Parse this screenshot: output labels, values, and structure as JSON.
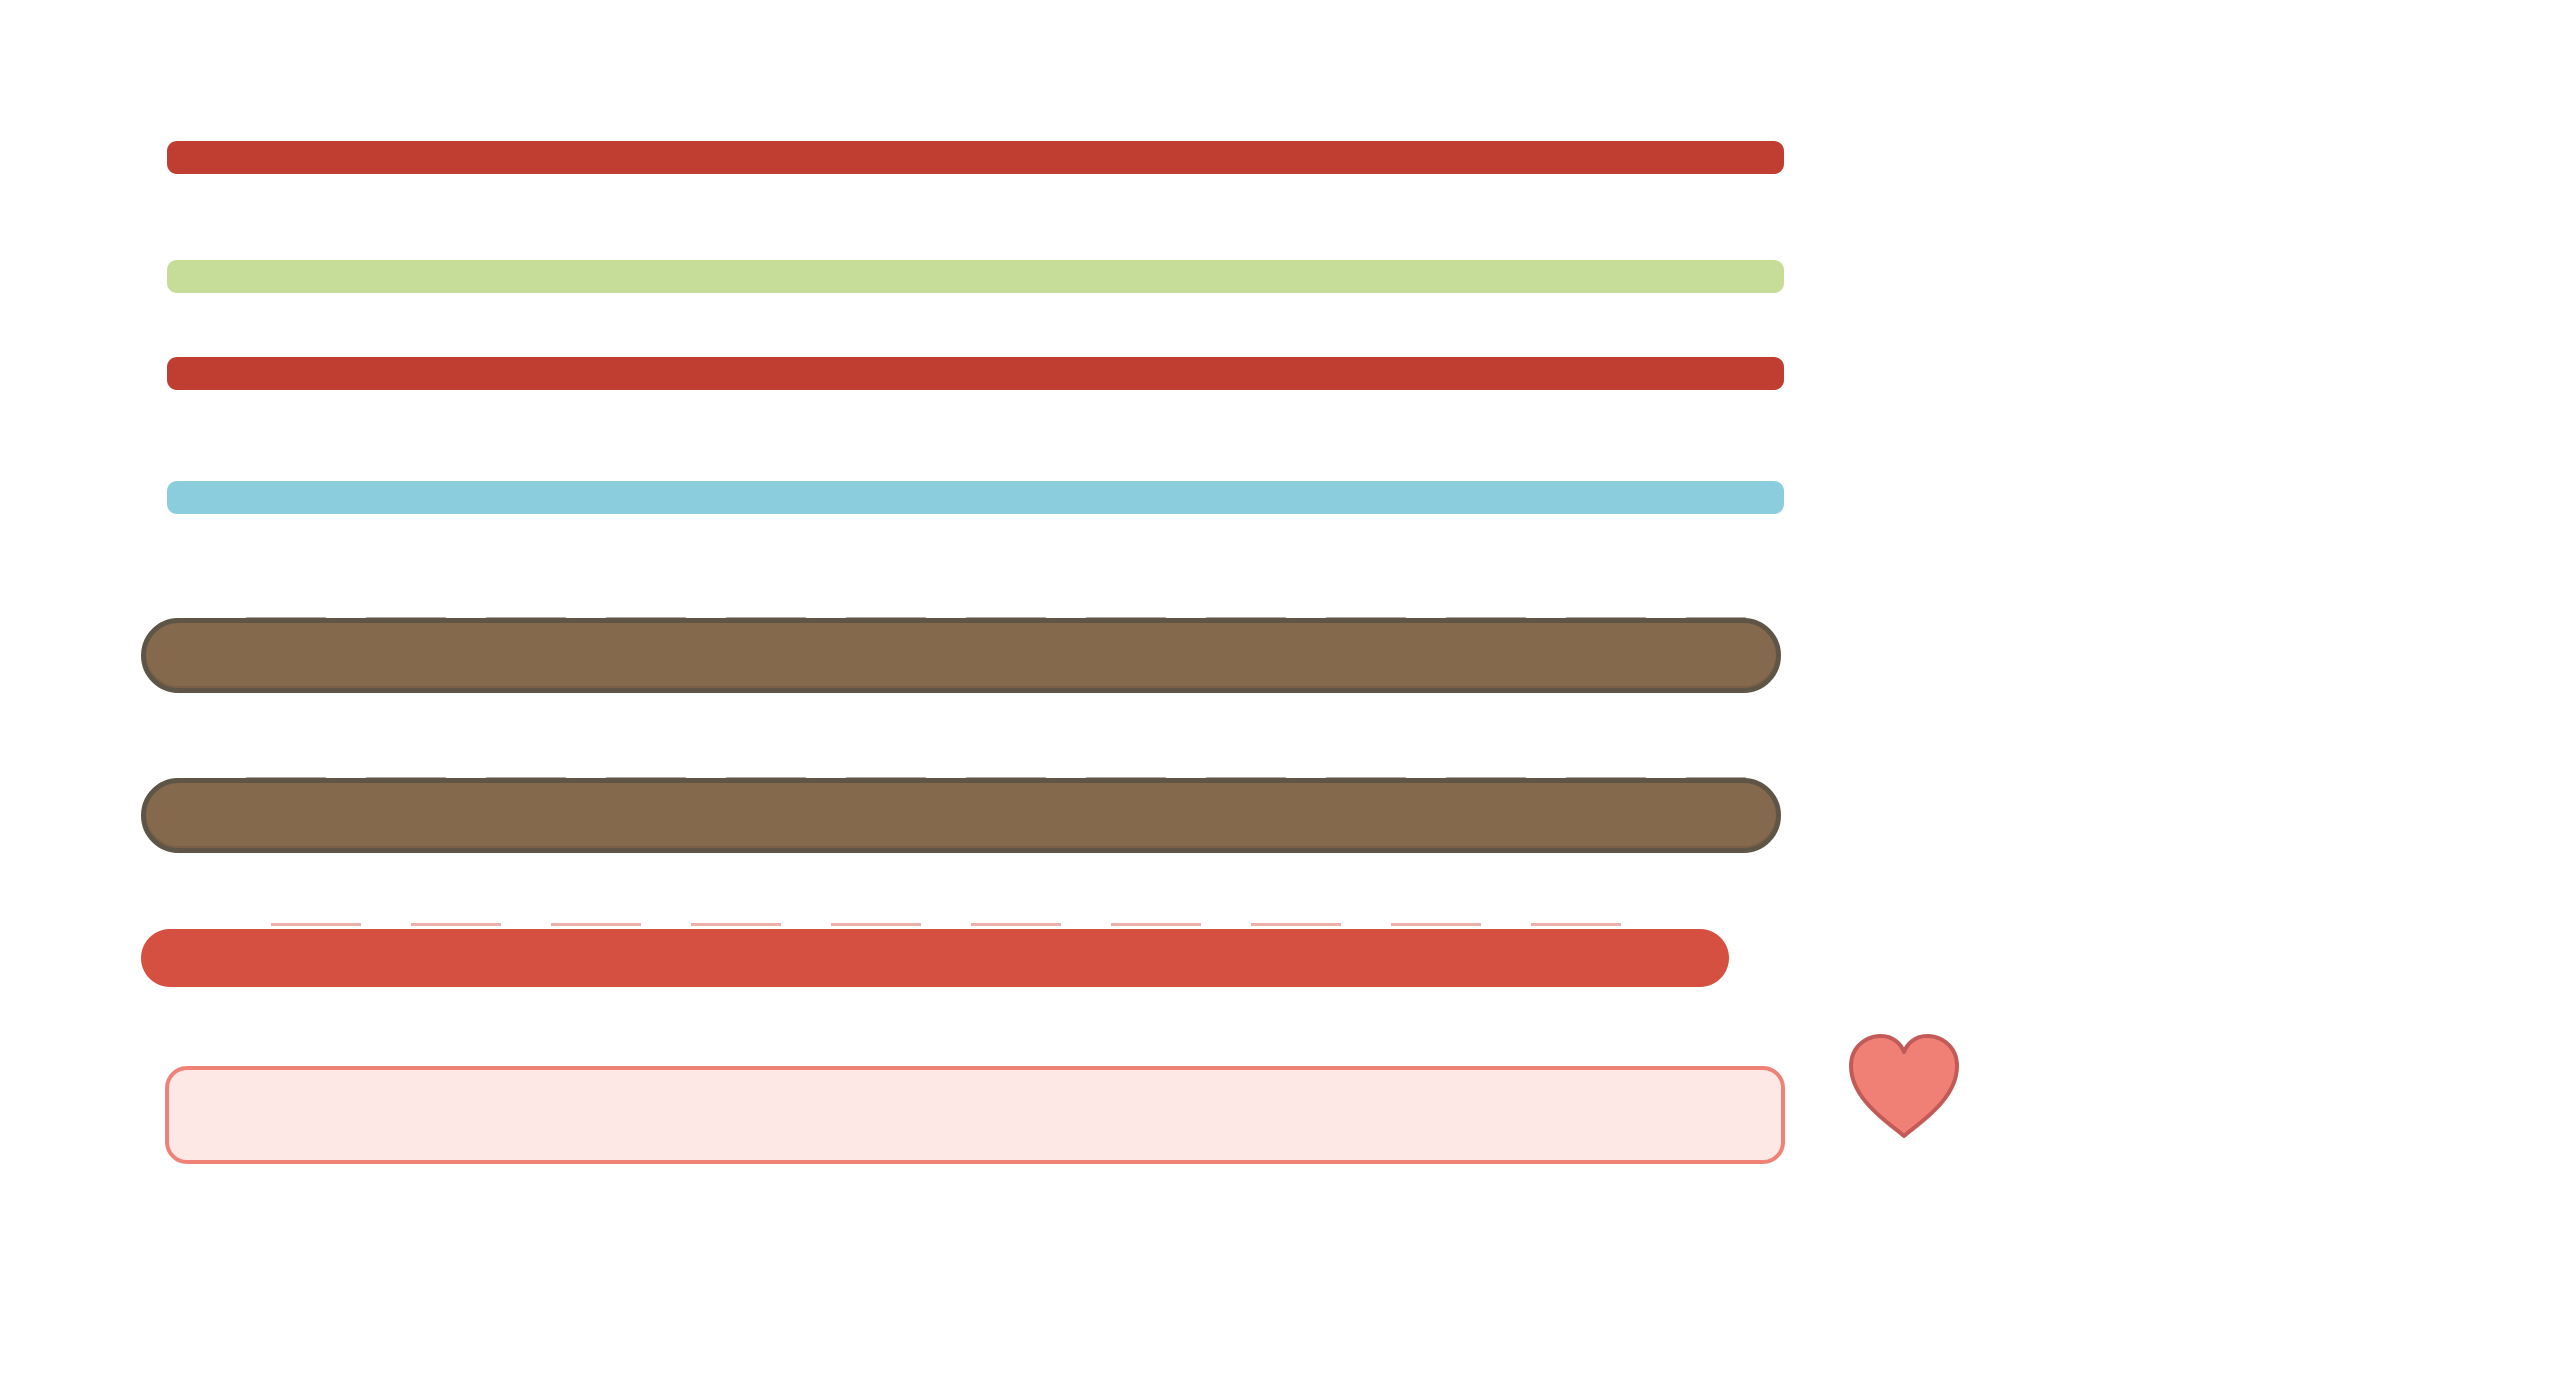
{
  "colors": {
    "red": "#bf3d31",
    "green": "#c5dd98",
    "blue": "#8bcddd",
    "brown_fill": "#84694d",
    "brown_outline": "#5f5547",
    "brush_red": "#d55040",
    "pink_fill": "#fde8e5",
    "pink_outline": "#ee8276",
    "heart_fill": "#f08075",
    "heart_outline": "#c25b57"
  },
  "icons": {
    "heart": "heart-icon"
  }
}
